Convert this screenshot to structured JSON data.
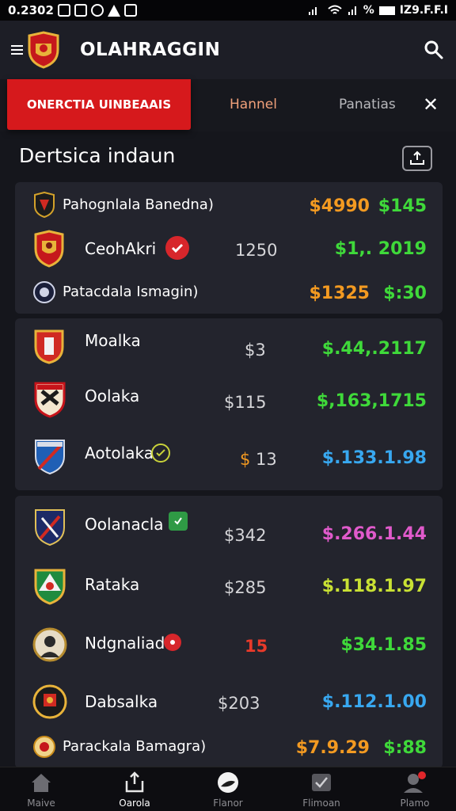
{
  "status_bar": {
    "time": "0.2302",
    "right_text": "%",
    "right_time": "IZ9.F.F.I"
  },
  "app_bar": {
    "title": "OLAHRAGGIN",
    "logo": "crest-logo",
    "search_icon": "search-icon"
  },
  "tabs": [
    {
      "label": "ONERCTIA UINBEAAIS",
      "active": true
    },
    {
      "label": "Hannel",
      "active": false
    },
    {
      "label": "Panatias",
      "active": false
    }
  ],
  "close_icon": "close-icon",
  "section": {
    "title": "Dertsica indaun",
    "action_icon": "share-icon"
  },
  "card1": {
    "header": {
      "name": "Pahognlala Banedna)",
      "val1": "$4990",
      "val2": "$145"
    },
    "row": {
      "name": "CeohAkri",
      "mid": "1250",
      "value": "$1,. 2019"
    },
    "footer": {
      "name": "Patacdala Ismagin)",
      "val1": "$1325",
      "val2": "$:30"
    }
  },
  "card2": [
    {
      "name": "Moalka",
      "mid": "$3",
      "value": "$.44,.2117"
    },
    {
      "name": "Oolaka",
      "mid": "$115",
      "value": "$,163,1715"
    },
    {
      "name": "Aotolaka",
      "mid": "$ 13",
      "value": "$.133.1.98"
    }
  ],
  "card3": [
    {
      "name": "Oolanacla",
      "mid": "$342",
      "value": "$.266.1.44"
    },
    {
      "name": "Rataka",
      "mid": "$285",
      "value": "$.118.1.97"
    },
    {
      "name": "Ndgnaliadi",
      "mid": "15",
      "value": "$34.1.85"
    },
    {
      "name": "Dabsalka",
      "mid": "$203",
      "value": "$.112.1.00"
    }
  ],
  "card3_footer": {
    "name": "Parackala Bamagra)",
    "val1": "$7.9.29",
    "val2": "$:88"
  },
  "bottom_nav": [
    {
      "label": "Maive",
      "icon": "home-icon"
    },
    {
      "label": "Oarola",
      "icon": "share-box-icon"
    },
    {
      "label": "Flanor",
      "icon": "ball-icon"
    },
    {
      "label": "Flimoan",
      "icon": "check-box-icon"
    },
    {
      "label": "Plamo",
      "icon": "profile-icon"
    }
  ],
  "colors": {
    "accent": "#d6191c",
    "background": "#15161c",
    "card": "#23242d",
    "green": "#3fd93a",
    "orange": "#f39a21",
    "blue": "#38a8f0"
  }
}
